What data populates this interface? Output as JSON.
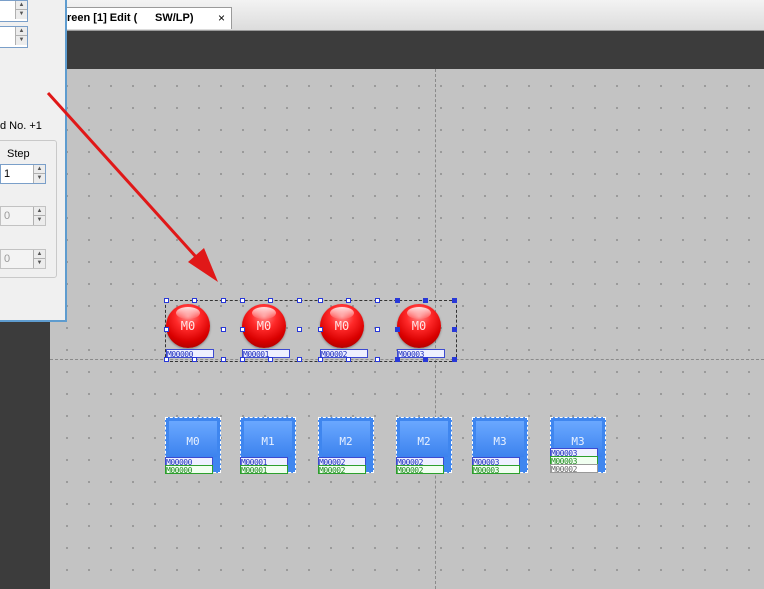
{
  "tab": {
    "title": "reen [1] Edit (",
    "title_suffix": "SW/LP)",
    "close_glyph": "×"
  },
  "dialog": {
    "word_label": "d No. +1",
    "group_label": "Step",
    "step_value": "1",
    "disabled_value_1": "0",
    "disabled_value_2": "0"
  },
  "lamps": [
    {
      "label": "M0",
      "tag": "M00000"
    },
    {
      "label": "M0",
      "tag": "M00001"
    },
    {
      "label": "M0",
      "tag": "M00002"
    },
    {
      "label": "M0",
      "tag": "M00003"
    }
  ],
  "switches": [
    {
      "label": "M0",
      "tag1": "M00000",
      "tag2": "M00000",
      "tag2_style": "green"
    },
    {
      "label": "M1",
      "tag1": "M00001",
      "tag2": "M00001",
      "tag2_style": "green"
    },
    {
      "label": "M2",
      "tag1": "M00002",
      "tag2": "M00002",
      "tag2_style": "green"
    },
    {
      "label": "M2",
      "tag1": "M00002",
      "tag2": "M00002",
      "tag2_style": "green"
    },
    {
      "label": "M3",
      "tag1": "M00003",
      "tag2": "M00003",
      "tag2_style": "green"
    },
    {
      "label": "M3",
      "tag1": "M00003",
      "tag2": "M00003",
      "tag3": "M00002",
      "tag2_style": "green"
    }
  ],
  "colors": {
    "lamp_red": "#ff2a2a",
    "switch_blue": "#3f86ef",
    "arrow": "#e01818",
    "selection": "#2838d8"
  },
  "icons": {
    "close": "close-icon",
    "spin_up": "spin-up-icon",
    "spin_down": "spin-down-icon",
    "arrow": "annotation-arrow"
  }
}
